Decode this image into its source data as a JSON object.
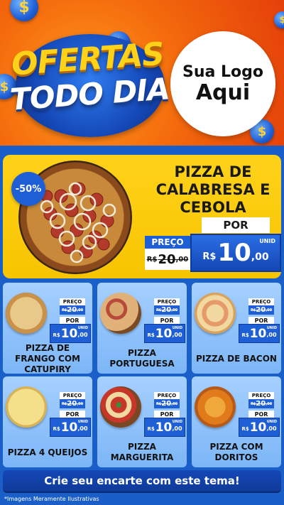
{
  "header": {
    "title_line1": "OFERTAS",
    "title_line2": "TODO DIA",
    "logo_line1": "Sua Logo",
    "logo_line2": "Aqui",
    "coin_symbol": "$"
  },
  "featured": {
    "discount": "-50%",
    "name": "PIZZA DE CALABRESA E CEBOLA",
    "preco_label": "PREÇO",
    "old_currency": "R$",
    "old_int": "20",
    "old_dec": ",00",
    "por_label": "POR",
    "unid_label": "UNID",
    "new_currency": "R$",
    "new_int": "10",
    "new_dec": ",00"
  },
  "products": [
    {
      "name": "PIZZA DE FRANGO COM CATUPIRY",
      "preco_label": "PREÇO",
      "old_currency": "R$",
      "old_int": "20",
      "old_dec": ",00",
      "por_label": "POR",
      "unid_label": "UNID",
      "new_currency": "R$",
      "new_int": "10",
      "new_dec": ",00"
    },
    {
      "name": "PIZZA PORTUGUESA",
      "preco_label": "PREÇO",
      "old_currency": "R$",
      "old_int": "20",
      "old_dec": ",00",
      "por_label": "POR",
      "unid_label": "UNID",
      "new_currency": "R$",
      "new_int": "10",
      "new_dec": ",00"
    },
    {
      "name": "PIZZA DE BACON",
      "preco_label": "PREÇO",
      "old_currency": "R$",
      "old_int": "20",
      "old_dec": ",00",
      "por_label": "POR",
      "unid_label": "UNID",
      "new_currency": "R$",
      "new_int": "10",
      "new_dec": ",00"
    },
    {
      "name": "PIZZA 4 QUEIJOS",
      "preco_label": "PREÇO",
      "old_currency": "R$",
      "old_int": "20",
      "old_dec": ",00",
      "por_label": "POR",
      "unid_label": "UNID",
      "new_currency": "R$",
      "new_int": "10",
      "new_dec": ",00"
    },
    {
      "name": "PIZZA MARGUERITA",
      "preco_label": "PREÇO",
      "old_currency": "R$",
      "old_int": "20",
      "old_dec": ",00",
      "por_label": "POR",
      "unid_label": "UNID",
      "new_currency": "R$",
      "new_int": "10",
      "new_dec": ",00"
    },
    {
      "name": "PIZZA COM DORITOS",
      "preco_label": "PREÇO",
      "old_currency": "R$",
      "old_int": "20",
      "old_dec": ",00",
      "por_label": "POR",
      "unid_label": "UNID",
      "new_currency": "R$",
      "new_int": "10",
      "new_dec": ",00"
    }
  ],
  "footer": {
    "cta": "Crie seu encarte com este tema!",
    "disclaimer": "*Imagens Meramente Ilustrativas"
  },
  "colors": {
    "accent_blue": "#1f5fd6",
    "accent_yellow": "#ffd21a",
    "header_orange": "#f46a0c",
    "card_blue": "#a6d0ff"
  }
}
